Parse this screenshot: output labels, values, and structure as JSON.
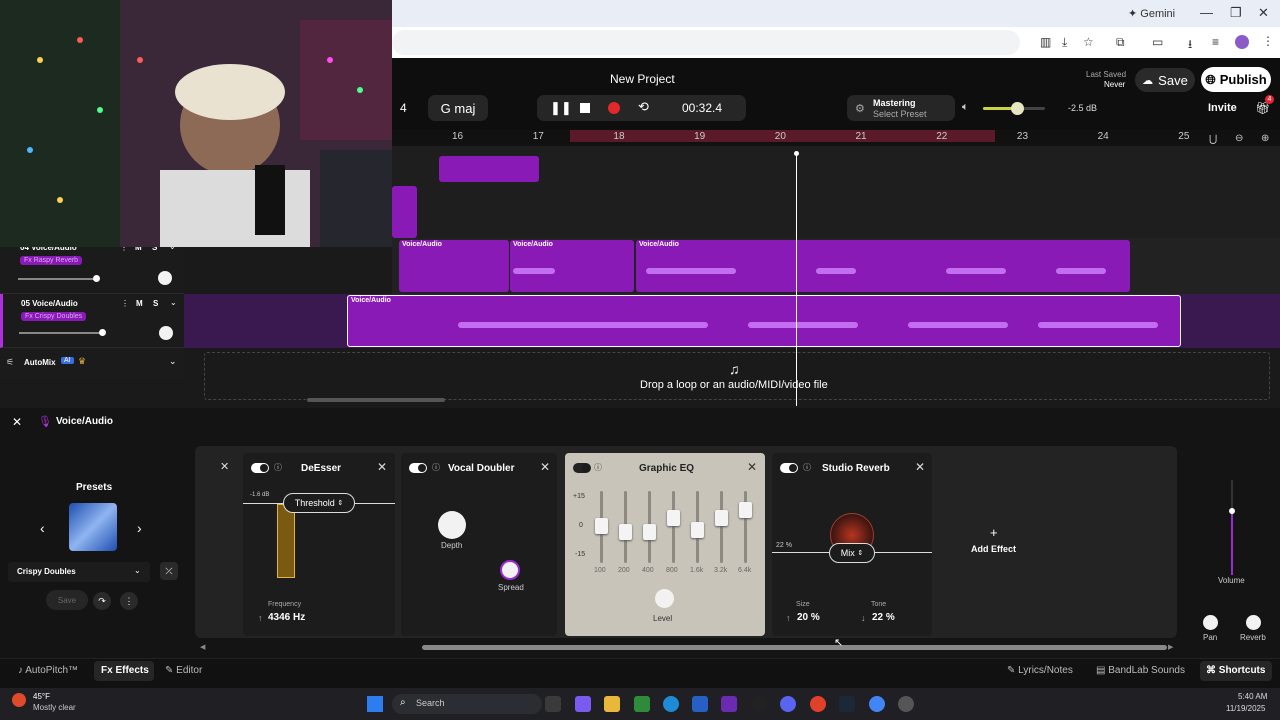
{
  "browser": {
    "gemini_label": "Gemini"
  },
  "header": {
    "project_title": "New Project",
    "time_sig_partial": "4",
    "key": "G maj",
    "time": "00:32.4",
    "mastering_label": "Mastering",
    "mastering_preset": "Select Preset",
    "volume_db": "-2.5 dB",
    "volume_level": 0.55,
    "last_saved_label": "Last Saved",
    "last_saved_value": "Never",
    "save_label": "Save",
    "publish_label": "Publish",
    "invite_label": "Invite",
    "gift_badge": "4"
  },
  "ruler": {
    "ticks": [
      "16",
      "17",
      "18",
      "19",
      "20",
      "21",
      "22",
      "23",
      "24",
      "25"
    ]
  },
  "tracks": [
    {
      "number": "04",
      "name": "Voice/Audio",
      "fx": "Fx Raspy Reverb",
      "mute": "M",
      "solo": "S",
      "clips": [
        "Voice/Audio",
        "Voice/Audio",
        "Voice/Audio"
      ]
    },
    {
      "number": "05",
      "name": "Voice/Audio",
      "fx": "Fx Crispy Doubles",
      "mute": "M",
      "solo": "S",
      "clips": [
        "Voice/Audio"
      ]
    }
  ],
  "automix": {
    "label": "AutoMix",
    "ai_badge": "AI"
  },
  "dropzone": {
    "text": "Drop a loop or an audio/MIDI/video file"
  },
  "fx_panel": {
    "track_title": "Voice/Audio",
    "presets_label": "Presets",
    "preset_name": "Crispy Doubles",
    "save_label": "Save",
    "deesser": {
      "title": "DeEsser",
      "db": "-1.6 dB",
      "mode": "Threshold",
      "freq_label": "Frequency",
      "freq_value": "4346 Hz"
    },
    "doubler": {
      "title": "Vocal Doubler",
      "depth_label": "Depth",
      "spread_label": "Spread"
    },
    "eq": {
      "title": "Graphic EQ",
      "scale": [
        "+15",
        "0",
        "-15"
      ],
      "bands": [
        "100",
        "200",
        "400",
        "800",
        "1.6k",
        "3.2k",
        "6.4k"
      ],
      "level_label": "Level"
    },
    "reverb": {
      "title": "Studio Reverb",
      "mix_pct": "22 %",
      "mix_label": "Mix",
      "size_label": "Size",
      "size_value": "20 %",
      "tone_label": "Tone",
      "tone_value": "22 %"
    },
    "add_effect": "Add Effect",
    "volume_label": "Volume",
    "pan_label": "Pan",
    "reverb_label": "Reverb"
  },
  "footer": {
    "autopitch": "AutoPitch™",
    "effects": "Effects",
    "editor": "Editor",
    "lyrics": "Lyrics/Notes",
    "sounds": "BandLab Sounds",
    "shortcuts": "Shortcuts"
  },
  "taskbar": {
    "temp": "45°F",
    "weather": "Mostly clear",
    "search": "Search",
    "time": "5:40 AM",
    "date": "11/19/2025"
  }
}
